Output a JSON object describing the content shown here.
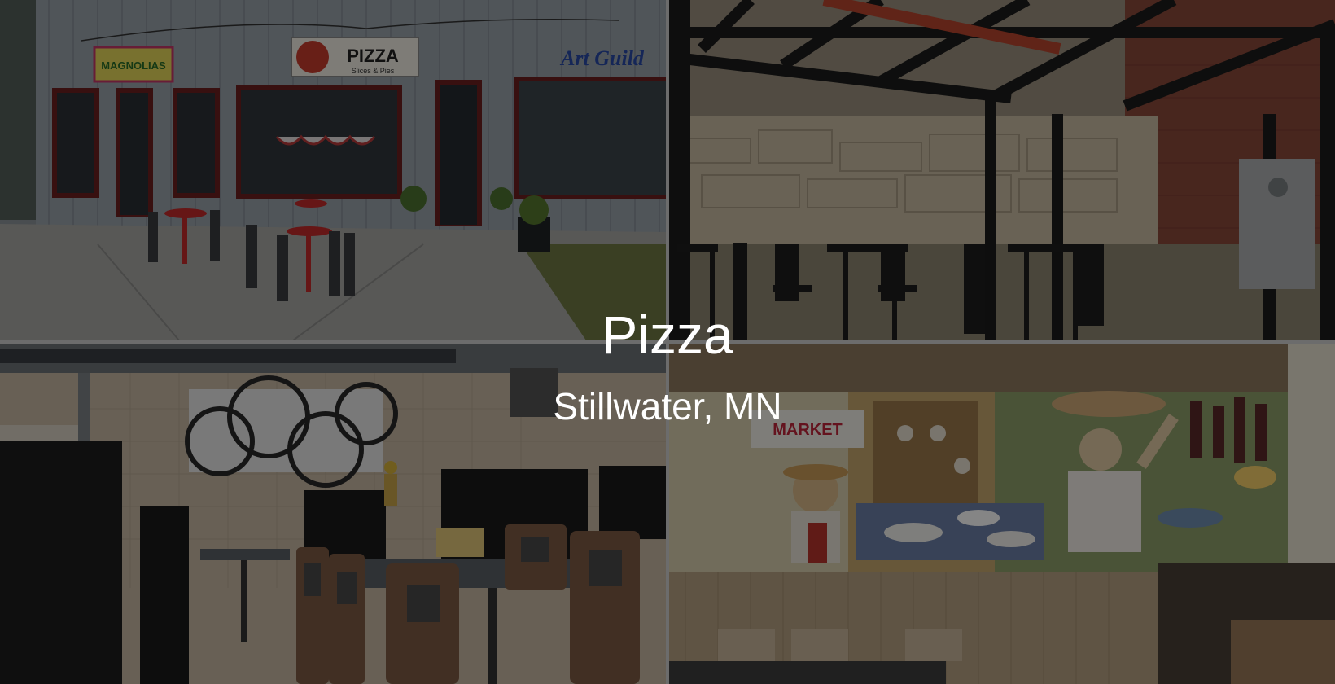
{
  "heading": {
    "title": "Pizza",
    "subtitle": "Stillwater, MN"
  },
  "photos": {
    "storefront": {
      "sign_magnolias": "MAGNOLIAS",
      "sign_pizza": "PIZZA",
      "sign_pizza_sub": "Slices & Pies",
      "sign_art_guild": "Art Guild"
    },
    "mural": {
      "sign_market": "MARKET"
    }
  },
  "colors": {
    "overlay": "#000000",
    "text": "#ffffff",
    "gutter": "#cfcfcf"
  }
}
